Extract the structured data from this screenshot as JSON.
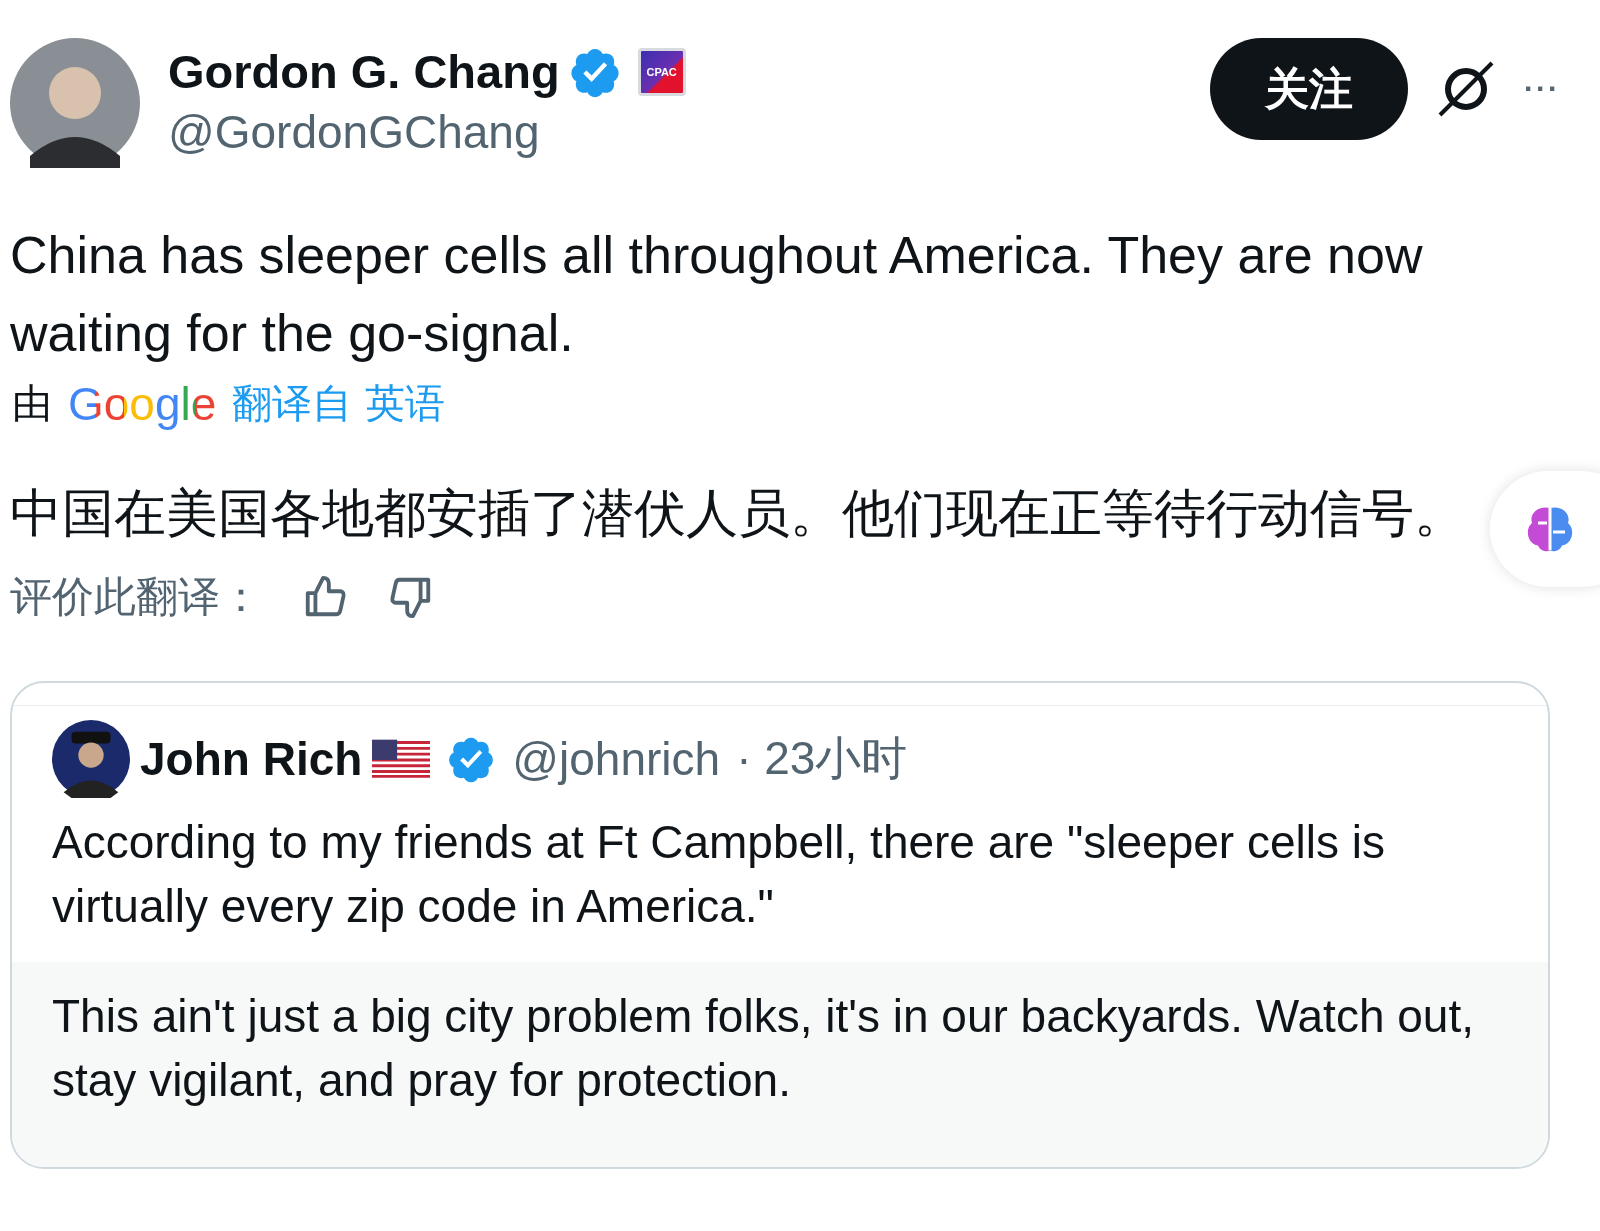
{
  "author": {
    "name": "Gordon G. Chang",
    "handle": "@GordonGChang",
    "verified": true,
    "affiliate": "CPAC"
  },
  "follow_button": "关注",
  "more_button": "···",
  "tweet_text": "China has sleeper cells all throughout America. They are now waiting for the go-signal.",
  "translation": {
    "by": "由",
    "provider": "Google",
    "source": "翻译自 英语",
    "text": "中国在美国各地都安插了潜伏人员。他们现在正等待行动信号。",
    "rate_label": "评价此翻译："
  },
  "quote": {
    "name": "John Rich",
    "handle": "@johnrich",
    "time": "· 23小时",
    "verified": true,
    "text": "According to my friends at Ft Campbell, there are \"sleeper cells is virtually every zip code in America.\"",
    "note": "This ain't just a big city problem folks, it's in our backyards. Watch out, stay vigilant, and pray for protection."
  }
}
